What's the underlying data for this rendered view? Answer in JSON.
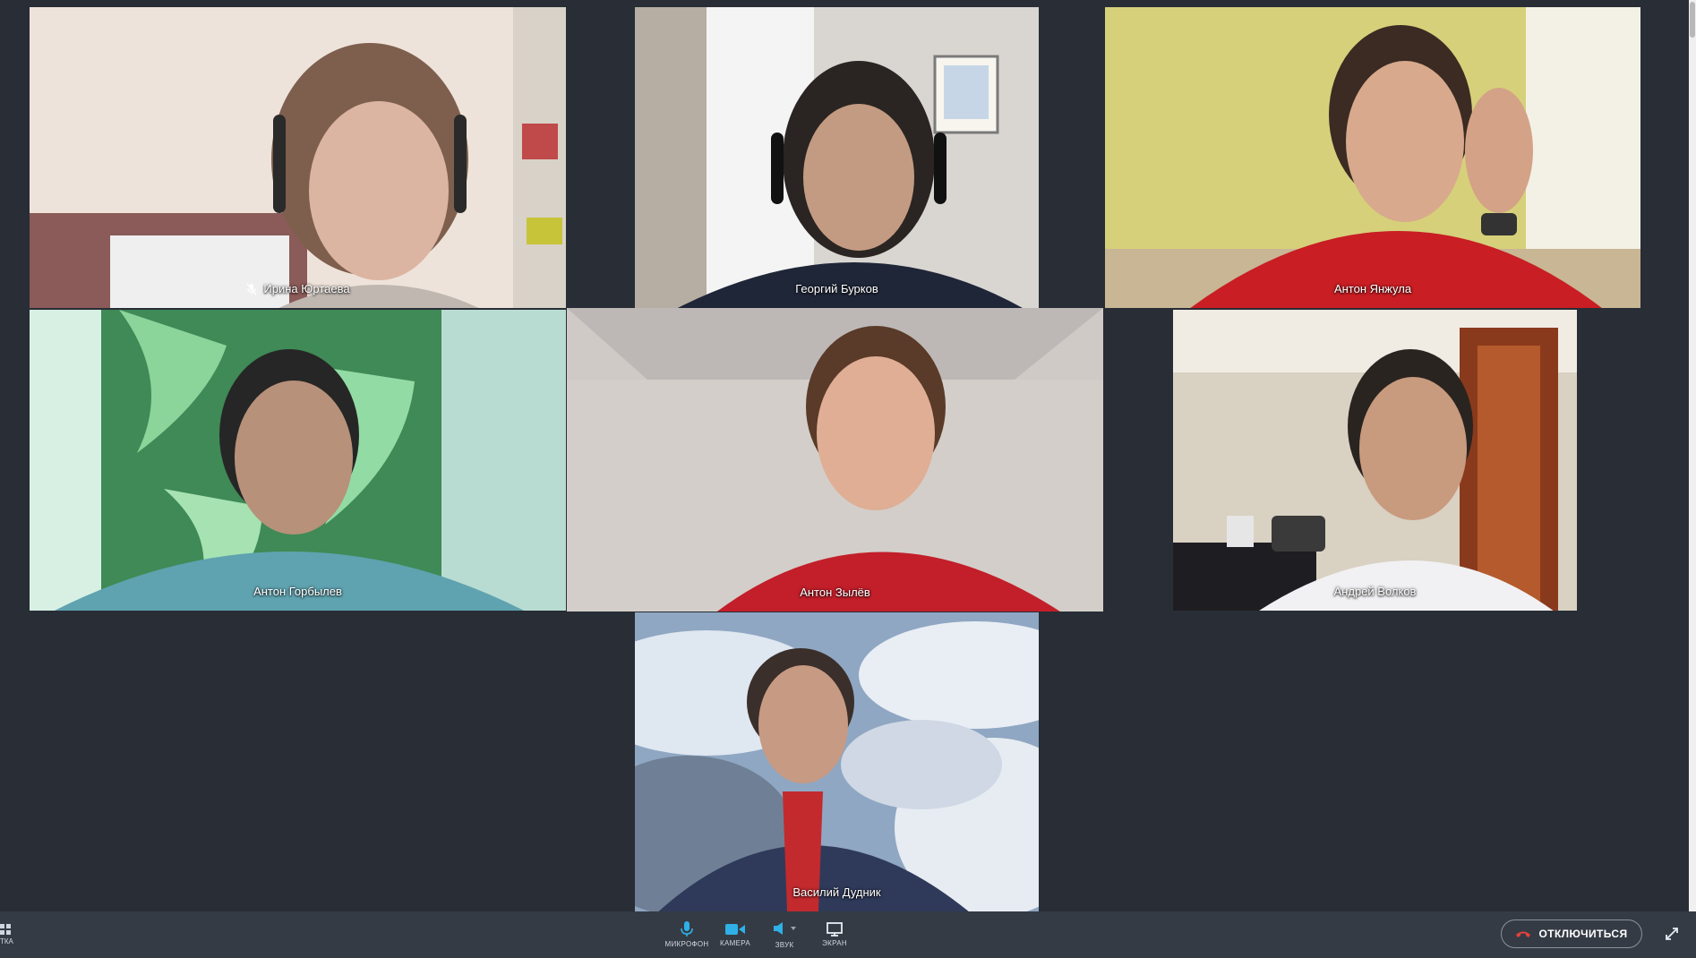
{
  "participants": [
    {
      "name": "Ирина Юртаева",
      "muted": true
    },
    {
      "name": "Георгий Бурков",
      "muted": false
    },
    {
      "name": "Антон Янжула",
      "muted": false
    },
    {
      "name": "Антон Горбылев",
      "muted": false
    },
    {
      "name": "Антон Зылёв",
      "muted": false,
      "active_speaker": true
    },
    {
      "name": "Андрей Волков",
      "muted": false
    },
    {
      "name": "Василий Дудник",
      "muted": false
    }
  ],
  "toolbar": {
    "grid_label": "ТКА",
    "mic_label": "МИКРОФОН",
    "camera_label": "КАМЕРА",
    "sound_label": "ЗВУК",
    "screen_label": "ЭКРАН",
    "hangup_label": "ОТКЛЮЧИТЬСЯ"
  },
  "colors": {
    "background": "#282d36",
    "toolbar": "#353b45",
    "accent": "#2fb0e6",
    "hangup_icon": "#e8403a"
  }
}
